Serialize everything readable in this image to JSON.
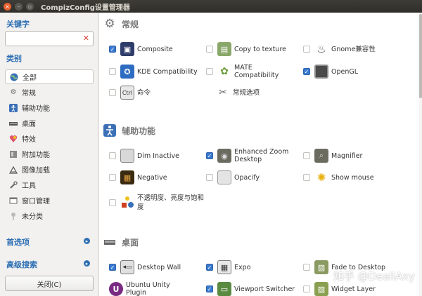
{
  "window": {
    "title": "CompizConfig设置管理器"
  },
  "colors": {
    "accent": "#2e6fb3",
    "titlebar": "#3d3c37",
    "checked": "#3a7ad0",
    "close_x": "#d43a32"
  },
  "sidebar": {
    "keyword_heading": "关键字",
    "search": {
      "value": "",
      "placeholder": ""
    },
    "category_heading": "类别",
    "categories": [
      {
        "label": "全部",
        "icon": "globe-icon",
        "selected": true
      },
      {
        "label": "常规",
        "icon": "gear-icon",
        "selected": false
      },
      {
        "label": "辅助功能",
        "icon": "accessibility-icon",
        "selected": false
      },
      {
        "label": "桌面",
        "icon": "desktop-icon",
        "selected": false
      },
      {
        "label": "特效",
        "icon": "effects-icon",
        "selected": false
      },
      {
        "label": "附加功能",
        "icon": "puzzle-icon",
        "selected": false
      },
      {
        "label": "图像加载",
        "icon": "image-loading-icon",
        "selected": false
      },
      {
        "label": "工具",
        "icon": "tools-icon",
        "selected": false
      },
      {
        "label": "窗口管理",
        "icon": "window-icon",
        "selected": false
      },
      {
        "label": "未分类",
        "icon": "pin-icon",
        "selected": false
      }
    ],
    "preferences_label": "首选项",
    "advanced_search_label": "高级搜索",
    "close_label": "关闭(C)"
  },
  "sections": [
    {
      "title": "常规",
      "icon": "gear-icon",
      "plugins": [
        {
          "label": "Composite",
          "checked": true,
          "icon": "composite-icon"
        },
        {
          "label": "Copy to texture",
          "checked": false,
          "icon": "copy-texture-icon"
        },
        {
          "label": "Gnome兼容性",
          "checked": false,
          "icon": "gnome-icon"
        },
        {
          "label": "KDE Compatibility",
          "checked": false,
          "icon": "kde-icon"
        },
        {
          "label": "MATE Compatibility",
          "checked": false,
          "icon": "mate-icon"
        },
        {
          "label": "OpenGL",
          "checked": true,
          "icon": "opengl-icon"
        },
        {
          "label": "命令",
          "checked": false,
          "icon": "command-icon"
        },
        {
          "label": "常规选项",
          "checked": null,
          "icon": "general-options-icon"
        }
      ]
    },
    {
      "title": "辅助功能",
      "icon": "accessibility-icon",
      "plugins": [
        {
          "label": "Dim Inactive",
          "checked": false,
          "icon": "dim-inactive-icon"
        },
        {
          "label": "Enhanced Zoom Desktop",
          "checked": true,
          "icon": "zoom-icon"
        },
        {
          "label": "Magnifier",
          "checked": false,
          "icon": "magnifier-icon"
        },
        {
          "label": "Negative",
          "checked": false,
          "icon": "negative-icon"
        },
        {
          "label": "Opacify",
          "checked": false,
          "icon": "opacify-icon"
        },
        {
          "label": "Show mouse",
          "checked": false,
          "icon": "show-mouse-icon"
        },
        {
          "label": "不透明度、亮度与饱和度",
          "checked": false,
          "icon": "opacity-brightness-icon"
        }
      ]
    },
    {
      "title": "桌面",
      "icon": "desktop-icon",
      "plugins": [
        {
          "label": "Desktop Wall",
          "checked": true,
          "icon": "desktop-wall-icon"
        },
        {
          "label": "Expo",
          "checked": true,
          "icon": "expo-icon"
        },
        {
          "label": "Fade to Desktop",
          "checked": false,
          "icon": "fade-desktop-icon"
        },
        {
          "label": "Ubuntu Unity Plugin",
          "checked": null,
          "icon": "unity-icon"
        },
        {
          "label": "Viewport Switcher",
          "checked": true,
          "icon": "viewport-icon"
        },
        {
          "label": "Widget Layer",
          "checked": false,
          "icon": "widget-layer-icon"
        }
      ]
    }
  ],
  "watermark": "知乎 @DealiAxy"
}
